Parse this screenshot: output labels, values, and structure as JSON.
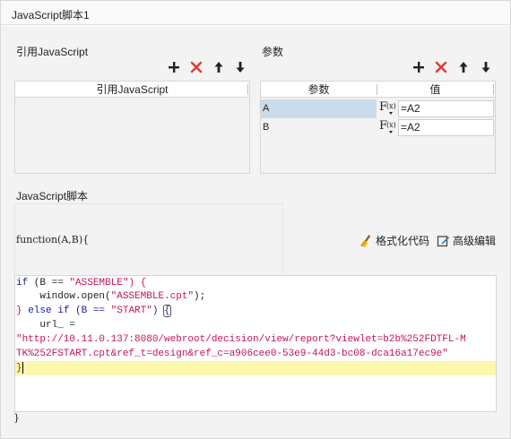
{
  "window": {
    "title": "JavaScript脚本1"
  },
  "referenced_js": {
    "label": "引用JavaScript",
    "column_header": "引用JavaScript",
    "rows": []
  },
  "params": {
    "label": "参数",
    "columns": [
      "参数",
      "值"
    ],
    "rows": [
      {
        "name": "A",
        "fx": "F(x)",
        "value": "=A2"
      },
      {
        "name": "B",
        "fx": "F(x)",
        "value": "=A2"
      }
    ]
  },
  "toolbar_icons": [
    "add-icon",
    "delete-icon",
    "move-up-icon",
    "move-down-icon"
  ],
  "script": {
    "label": "JavaScript脚本",
    "signature": "function(A,B){",
    "closing": "}",
    "format_label": "格式化代码",
    "advanced_label": "高级编辑",
    "lines": {
      "l1_if": "if",
      "l1_mid": " (B == ",
      "l1_str": "\"ASSEMBLE\"",
      "l1_end": ") {",
      "l2_pre": "    window.open(",
      "l2_str": "\"ASSEMBLE.cpt\"",
      "l2_end": ");",
      "l3_brace": "}",
      "l3_kw": " else if",
      "l3_mid": " (B == ",
      "l3_str": "\"START\"",
      "l3_end": ") ",
      "l3_open": "{",
      "l4": "    url_ =",
      "l5": "\"http://10.11.0.137:8080/webroot/decision/view/report?viewlet=b2b%252FDTFL-M",
      "l6": "TK%252FSTART.cpt&ref_t=design&ref_c=a906cee0-53e9-44d3-bc08-dca16a17ec9e\"",
      "l7": "}"
    }
  },
  "colors": {
    "keyword": "#1a1aa6",
    "string": "#c4135b",
    "delete": "#e03a2f",
    "selected_row": "#c9dcec",
    "current_line": "#fbf7ad"
  }
}
